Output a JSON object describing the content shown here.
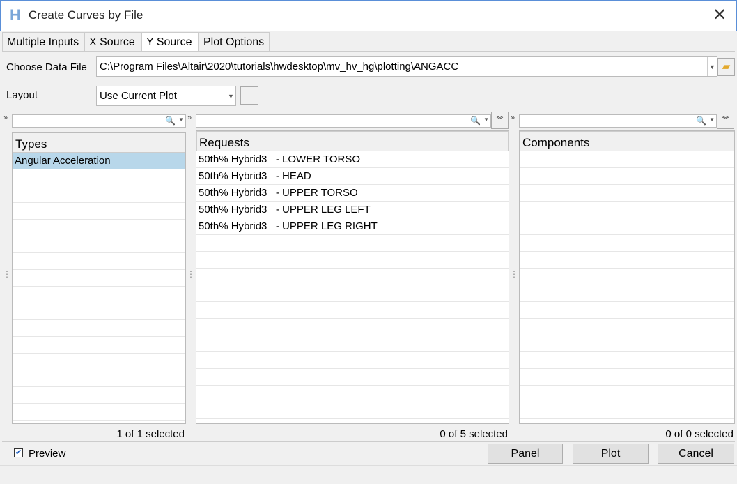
{
  "window": {
    "title": "Create Curves by File"
  },
  "tabs": [
    {
      "label": "Multiple Inputs"
    },
    {
      "label": "X Source"
    },
    {
      "label": "Y Source"
    },
    {
      "label": "Plot Options"
    }
  ],
  "data_file": {
    "label": "Choose Data File",
    "value": "C:\\Program Files\\Altair\\2020\\tutorials\\hwdesktop\\mv_hv_hg\\plotting\\ANGACC"
  },
  "layout": {
    "label": "Layout",
    "value": "Use Current Plot"
  },
  "types": {
    "header": "Types",
    "items": [
      "Angular Acceleration"
    ],
    "status": "1 of 1 selected"
  },
  "requests": {
    "header": "Requests",
    "items": [
      "50th% Hybrid3   - LOWER TORSO",
      "50th% Hybrid3   - HEAD",
      "50th% Hybrid3   - UPPER TORSO",
      "50th% Hybrid3   - UPPER LEG LEFT",
      "50th% Hybrid3   - UPPER LEG RIGHT"
    ],
    "status": "0 of 5 selected"
  },
  "components": {
    "header": "Components",
    "items": [],
    "status": "0 of 0 selected"
  },
  "footer": {
    "preview_label": "Preview",
    "preview_checked": true,
    "panel": "Panel",
    "plot": "Plot",
    "cancel": "Cancel"
  }
}
